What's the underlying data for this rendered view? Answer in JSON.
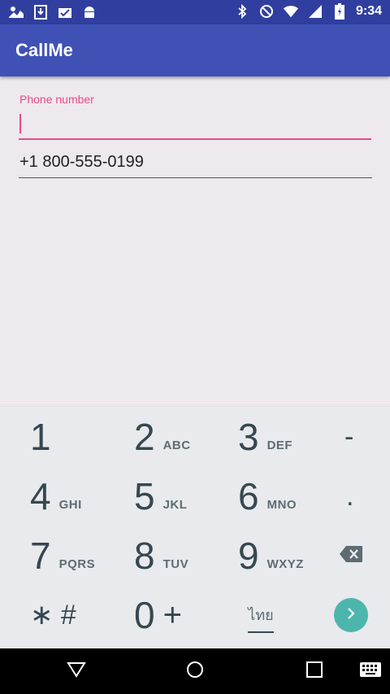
{
  "status_bar": {
    "time": "9:34",
    "left_icons": [
      "notification-icon",
      "download-icon",
      "checklist-icon",
      "android-icon"
    ],
    "right_icons": [
      "bluetooth-icon",
      "do-not-disturb-icon",
      "wifi-icon",
      "signal-icon",
      "battery-icon"
    ],
    "color": "#303F9F"
  },
  "app_bar": {
    "title": "CallMe",
    "color": "#3F51B5"
  },
  "form": {
    "phone_label": "Phone number",
    "phone_value": "",
    "second_value": "+1 800-555-0199",
    "accent_color": "#E84A85"
  },
  "keypad": {
    "keys": [
      {
        "digit": "1",
        "letters": ""
      },
      {
        "digit": "2",
        "letters": "ABC"
      },
      {
        "digit": "3",
        "letters": "DEF"
      },
      {
        "digit": "4",
        "letters": "GHI"
      },
      {
        "digit": "5",
        "letters": "JKL"
      },
      {
        "digit": "6",
        "letters": "MNO"
      },
      {
        "digit": "7",
        "letters": "PQRS"
      },
      {
        "digit": "8",
        "letters": "TUV"
      },
      {
        "digit": "9",
        "letters": "WXYZ"
      },
      {
        "digit": "0",
        "letters": "+"
      }
    ],
    "star_hash": "∗ #",
    "dash": "-",
    "dot": ".",
    "language": "ไทย",
    "go_color": "#4DB6AC"
  },
  "nav_bar": {
    "icons": [
      "back-icon",
      "home-icon",
      "recents-icon",
      "keyboard-icon"
    ]
  }
}
